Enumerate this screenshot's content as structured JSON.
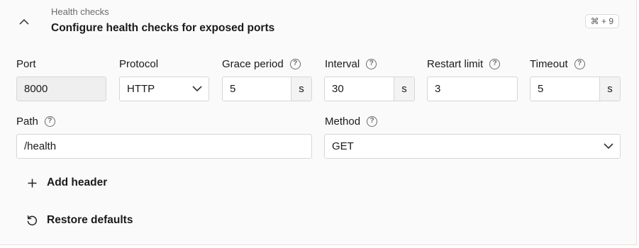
{
  "section": {
    "subtitle": "Health checks",
    "title": "Configure health checks for exposed ports",
    "shortcut": "⌘ + 9"
  },
  "fields": {
    "port": {
      "label": "Port",
      "value": "8000"
    },
    "protocol": {
      "label": "Protocol",
      "value": "HTTP"
    },
    "grace_period": {
      "label": "Grace period",
      "value": "5",
      "unit": "s"
    },
    "interval": {
      "label": "Interval",
      "value": "30",
      "unit": "s"
    },
    "restart_limit": {
      "label": "Restart limit",
      "value": "3"
    },
    "timeout": {
      "label": "Timeout",
      "value": "5",
      "unit": "s"
    },
    "path": {
      "label": "Path",
      "value": "/health"
    },
    "method": {
      "label": "Method",
      "value": "GET"
    }
  },
  "help_glyph": "?",
  "actions": {
    "add_header": "Add header",
    "restore_defaults": "Restore defaults"
  },
  "icons": {
    "collapse": "chevron-up-icon",
    "select": "chevron-down-icon",
    "help": "help-circle-icon",
    "add": "plus-icon",
    "restore": "restore-icon"
  }
}
